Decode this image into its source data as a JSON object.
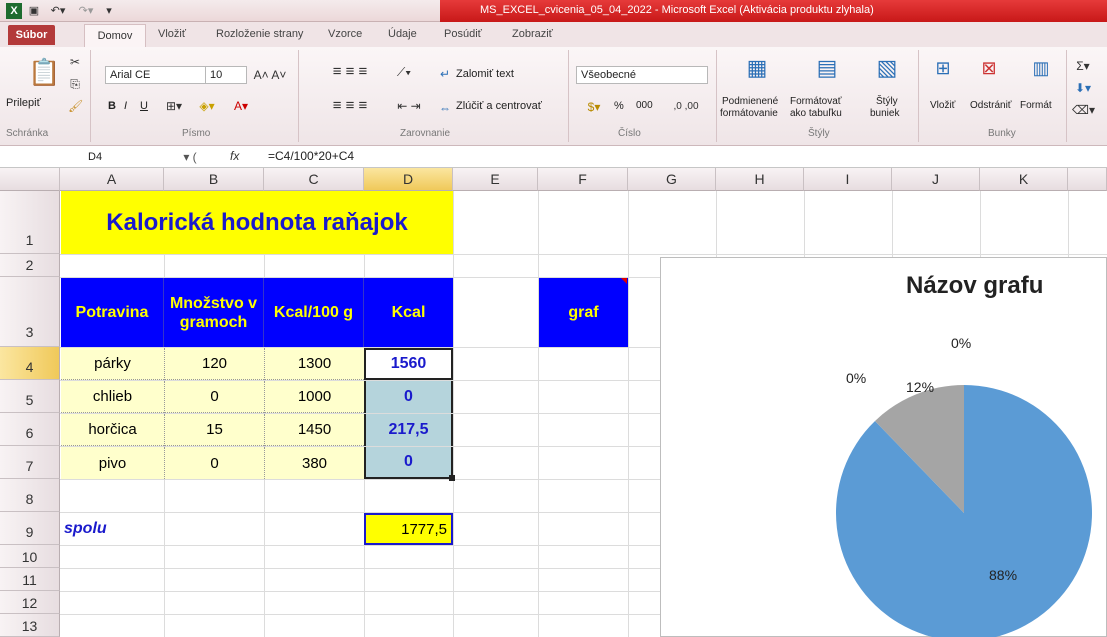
{
  "window": {
    "title": "MS_EXCEL_cvicenia_05_04_2022  -  Microsoft Excel (Aktivácia produktu zlyhala)"
  },
  "tabs": [
    "Súbor",
    "Domov",
    "Vložiť",
    "Rozloženie strany",
    "Vzorce",
    "Údaje",
    "Posúdiť",
    "Zobraziť"
  ],
  "ribbon": {
    "clipboard": {
      "paste": "Prilepiť",
      "group": "Schránka"
    },
    "font": {
      "name": "Arial CE",
      "size": "10",
      "group": "Písmo",
      "bold": "B",
      "italic": "I",
      "underline": "U"
    },
    "alignment": {
      "wrap": "Zalomiť text",
      "merge": "Zlúčiť a centrovať",
      "group": "Zarovnanie"
    },
    "number": {
      "format": "Všeobecné",
      "percent": "%",
      "thousands": "000",
      "group": "Číslo"
    },
    "styles": {
      "conditional": "Podmienené formátovanie",
      "table": "Formátovať ako tabuľku",
      "cell": "Štýly buniek",
      "group": "Štýly",
      "cf_line1": "Podmienené",
      "cf_line2": "formátovanie",
      "t_line1": "Formátovať",
      "t_line2": "ako tabuľku",
      "c_line1": "Štýly",
      "c_line2": "buniek"
    },
    "cells": {
      "insert": "Vložiť",
      "delete": "Odstrániť",
      "format": "Formát",
      "group": "Bunky"
    }
  },
  "formula_bar": {
    "name_box": "D4",
    "fx": "fx",
    "formula": "=C4/100*20+C4"
  },
  "columns": [
    "A",
    "B",
    "C",
    "D",
    "E",
    "F",
    "G",
    "H",
    "I",
    "J",
    "K"
  ],
  "rows": [
    "1",
    "2",
    "3",
    "4",
    "5",
    "6",
    "7",
    "8",
    "9",
    "10",
    "11",
    "12",
    "13"
  ],
  "sheet": {
    "title": "Kalorická hodnota raňajok",
    "headers": {
      "a": "Potravina",
      "b": "Množstvo v gramoch",
      "c": "Kcal/100 g",
      "d": "Kcal"
    },
    "graf_label": "graf",
    "data": [
      {
        "name": "párky",
        "qty": "120",
        "kcal100": "1300",
        "kcal": "1560"
      },
      {
        "name": "chlieb",
        "qty": "0",
        "kcal100": "1000",
        "kcal": "0"
      },
      {
        "name": "horčica",
        "qty": "15",
        "kcal100": "1450",
        "kcal": "217,5"
      },
      {
        "name": "pivo",
        "qty": "0",
        "kcal100": "380",
        "kcal": "0"
      }
    ],
    "sum_label": "spolu",
    "sum_value": "1777,5"
  },
  "chart_data": {
    "type": "pie",
    "title": "Názov grafu",
    "values": [
      1560,
      0,
      217.5,
      0
    ],
    "categories": [
      "párky",
      "chlieb",
      "horčica",
      "pivo"
    ],
    "labels": [
      "88%",
      "0%",
      "12%",
      "0%"
    ],
    "colors": [
      "#5b9bd5",
      "#ed7d31",
      "#a5a5a5",
      "#ffc000"
    ]
  }
}
